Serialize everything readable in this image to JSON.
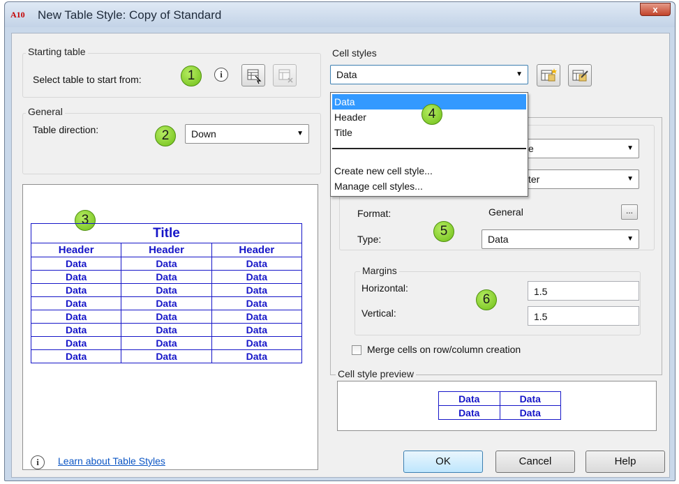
{
  "window": {
    "title": "New Table Style: Copy of Standard",
    "app_icon": "A10",
    "close_glyph": "x"
  },
  "starting_table": {
    "group_label": "Starting table",
    "select_label": "Select table to start from:",
    "callout": "1"
  },
  "general": {
    "group_label": "General",
    "direction_label": "Table direction:",
    "direction_value": "Down",
    "callout": "2"
  },
  "table_preview": {
    "callout": "3",
    "title": "Title",
    "headers": [
      "Header",
      "Header",
      "Header"
    ],
    "rows": [
      [
        "Data",
        "Data",
        "Data"
      ],
      [
        "Data",
        "Data",
        "Data"
      ],
      [
        "Data",
        "Data",
        "Data"
      ],
      [
        "Data",
        "Data",
        "Data"
      ],
      [
        "Data",
        "Data",
        "Data"
      ],
      [
        "Data",
        "Data",
        "Data"
      ],
      [
        "Data",
        "Data",
        "Data"
      ],
      [
        "Data",
        "Data",
        "Data"
      ]
    ]
  },
  "cell_styles": {
    "group_label": "Cell styles",
    "selected": "Data",
    "callout": "4",
    "dropdown": {
      "items": [
        "Data",
        "Header",
        "Title"
      ],
      "actions": [
        "Create new cell style...",
        "Manage cell styles..."
      ]
    },
    "hidden_combo1_partial": "e",
    "hidden_combo2_partial": "ter"
  },
  "properties": {
    "callout": "5",
    "format_label": "Format:",
    "format_value": "General",
    "format_button": "...",
    "type_label": "Type:",
    "type_value": "Data"
  },
  "margins": {
    "group_label": "Margins",
    "callout": "6",
    "horizontal_label": "Horizontal:",
    "horizontal_value": "1.5",
    "vertical_label": "Vertical:",
    "vertical_value": "1.5"
  },
  "merge_label": "Merge cells on row/column creation",
  "cell_preview": {
    "group_label": "Cell style preview",
    "rows": [
      [
        "Data",
        "Data"
      ],
      [
        "Data",
        "Data"
      ]
    ]
  },
  "footer": {
    "learn_link": "Learn about Table Styles",
    "ok": "OK",
    "cancel": "Cancel",
    "help": "Help"
  }
}
